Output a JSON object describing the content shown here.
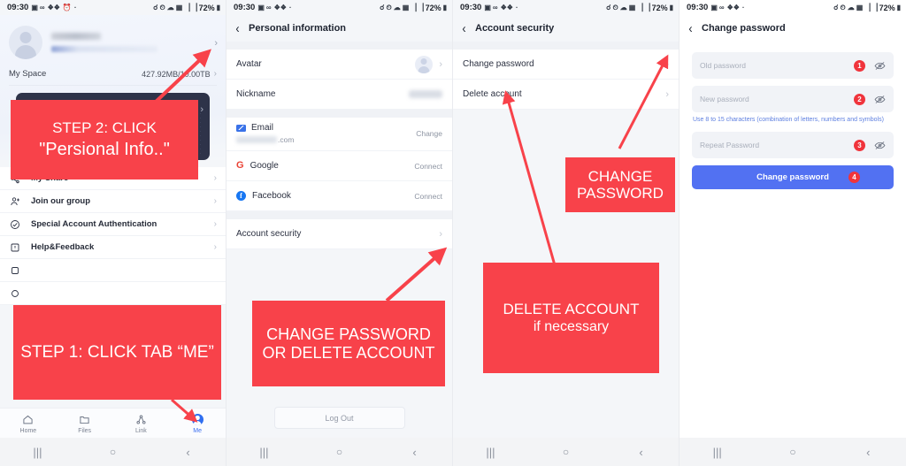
{
  "status_bar": {
    "time": "09:30",
    "battery": "72%",
    "left_icons": [
      "image-icon",
      "link-icon",
      "dots-icon",
      "alarm-icon",
      "dot-icon"
    ],
    "right_icons": [
      "vpn-key-icon",
      "alarm-icon",
      "wifi-icon",
      "sim-icon",
      "signal-icon",
      "signal-icon"
    ]
  },
  "nav_bar": {
    "recents": "|||",
    "home": "○",
    "back": "‹"
  },
  "panel1": {
    "profile": {
      "avatar": "user-avatar",
      "name_redacted": "",
      "email_redacted": "",
      "chevron": "›"
    },
    "space": {
      "label": "My Space",
      "value": "427.92MB/10.00TB",
      "chevron": "›"
    },
    "promo_card": {
      "chevron": "›"
    },
    "menu": [
      {
        "label": "My Share",
        "icon": "share-icon",
        "chevron": "›"
      },
      {
        "label": "Join our group",
        "icon": "group-add-icon",
        "chevron": "›"
      },
      {
        "label": "Special Account Authentication",
        "icon": "verified-icon",
        "chevron": "›"
      },
      {
        "label": "Help&Feedback",
        "icon": "help-icon",
        "chevron": "›"
      }
    ],
    "tabs": [
      {
        "label": "Home",
        "icon": "home-icon",
        "active": false
      },
      {
        "label": "Files",
        "icon": "folder-icon",
        "active": false
      },
      {
        "label": "Link",
        "icon": "link-share-icon",
        "active": false
      },
      {
        "label": "Me",
        "icon": "person-avatar-icon",
        "active": true
      }
    ]
  },
  "panel2": {
    "title": "Personal information",
    "back": "‹",
    "rows": {
      "avatar": {
        "label": "Avatar",
        "chevron": "›"
      },
      "nickname": {
        "label": "Nickname",
        "value_redacted": ""
      },
      "email": {
        "label": "Email",
        "value": ".com",
        "action": "Change",
        "icon": "mail-icon"
      },
      "google": {
        "label": "Google",
        "action": "Connect",
        "icon": "google-icon",
        "glyph": "G"
      },
      "facebook": {
        "label": "Facebook",
        "action": "Connect",
        "icon": "facebook-icon",
        "glyph": "f"
      },
      "account_security": {
        "label": "Account security",
        "chevron": "›"
      }
    },
    "logout": "Log Out"
  },
  "panel3": {
    "title": "Account security",
    "back": "‹",
    "rows": [
      {
        "label": "Change password",
        "chevron": "›"
      },
      {
        "label": "Delete account",
        "chevron": "›"
      }
    ]
  },
  "panel4": {
    "title": "Change password",
    "back": "‹",
    "fields": [
      {
        "placeholder": "Old password",
        "step": "1",
        "eye": "eye-off-icon"
      },
      {
        "placeholder": "New password",
        "step": "2",
        "eye": "eye-off-icon"
      },
      {
        "placeholder": "Repeat Password",
        "step": "3",
        "eye": "eye-off-icon"
      }
    ],
    "hint": "Use 8 to 15 characters (combination of letters, numbers and symbols)",
    "submit": {
      "label": "Change password",
      "step": "4"
    }
  },
  "annotations": {
    "step1": {
      "line1": "STEP 1: CLICK TAB “ME”"
    },
    "step2": {
      "line1": "STEP 2: CLICK",
      "line2": "\"Persional Info..\""
    },
    "change_or_delete": {
      "line1": "CHANGE PASSWORD",
      "line2": "OR DELETE ACCOUNT"
    },
    "change_password": {
      "line1": "CHANGE",
      "line2": "PASSWORD"
    },
    "delete_account": {
      "line1": "DELETE ACCOUNT",
      "line2": "if necessary"
    }
  },
  "colors": {
    "accent_red": "#f8424a",
    "accent_blue": "#5271f2",
    "badge_red": "#f0343c",
    "dark_card": "#2e3349",
    "hint_blue": "#5d7fe0"
  }
}
